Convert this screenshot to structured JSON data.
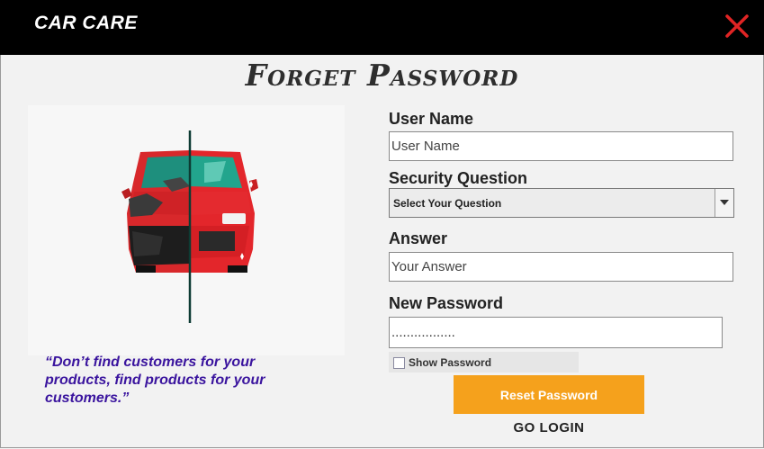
{
  "header": {
    "brand": "CAR CARE",
    "close_icon": "close-icon"
  },
  "page": {
    "title": "Forget Password"
  },
  "illustration": {
    "icon": "car-repair-illustration"
  },
  "quote": "“Don’t find customers for your products, find products for your customers.”",
  "form": {
    "username": {
      "label": "User Name",
      "placeholder": "User Name"
    },
    "security_question": {
      "label": "Security Question",
      "selected": "Select Your Question"
    },
    "answer": {
      "label": "Answer",
      "placeholder": "Your Answer"
    },
    "new_password": {
      "label": "New Password",
      "value": "................."
    },
    "show_password": {
      "label": "Show Password",
      "checked": false
    },
    "reset_button": "Reset Password",
    "go_login": "GO LOGIN"
  },
  "colors": {
    "topbar": "#000000",
    "close": "#e02424",
    "accent_button": "#f5a11c",
    "quote": "#3a149e"
  }
}
